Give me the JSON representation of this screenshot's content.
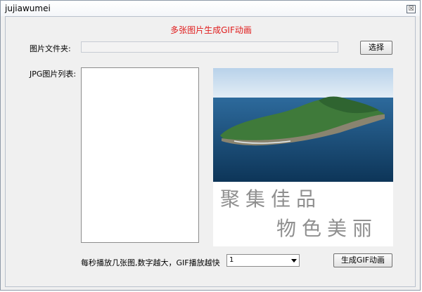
{
  "window": {
    "title": "jujiawumei"
  },
  "main": {
    "heading": "多张图片生成GIF动画",
    "folder_label": "图片文件夹:",
    "folder_path": "",
    "choose_button": "选择",
    "list_label": "JPG图片列表:",
    "jpg_list": [],
    "speed_label": "每秒播放几张图,数字越大，GIF播放越快",
    "speed_value": "1",
    "generate_button": "生成GIF动画"
  },
  "preview": {
    "calligraphy_line1": "聚集佳品",
    "calligraphy_line2": "物色美丽"
  }
}
